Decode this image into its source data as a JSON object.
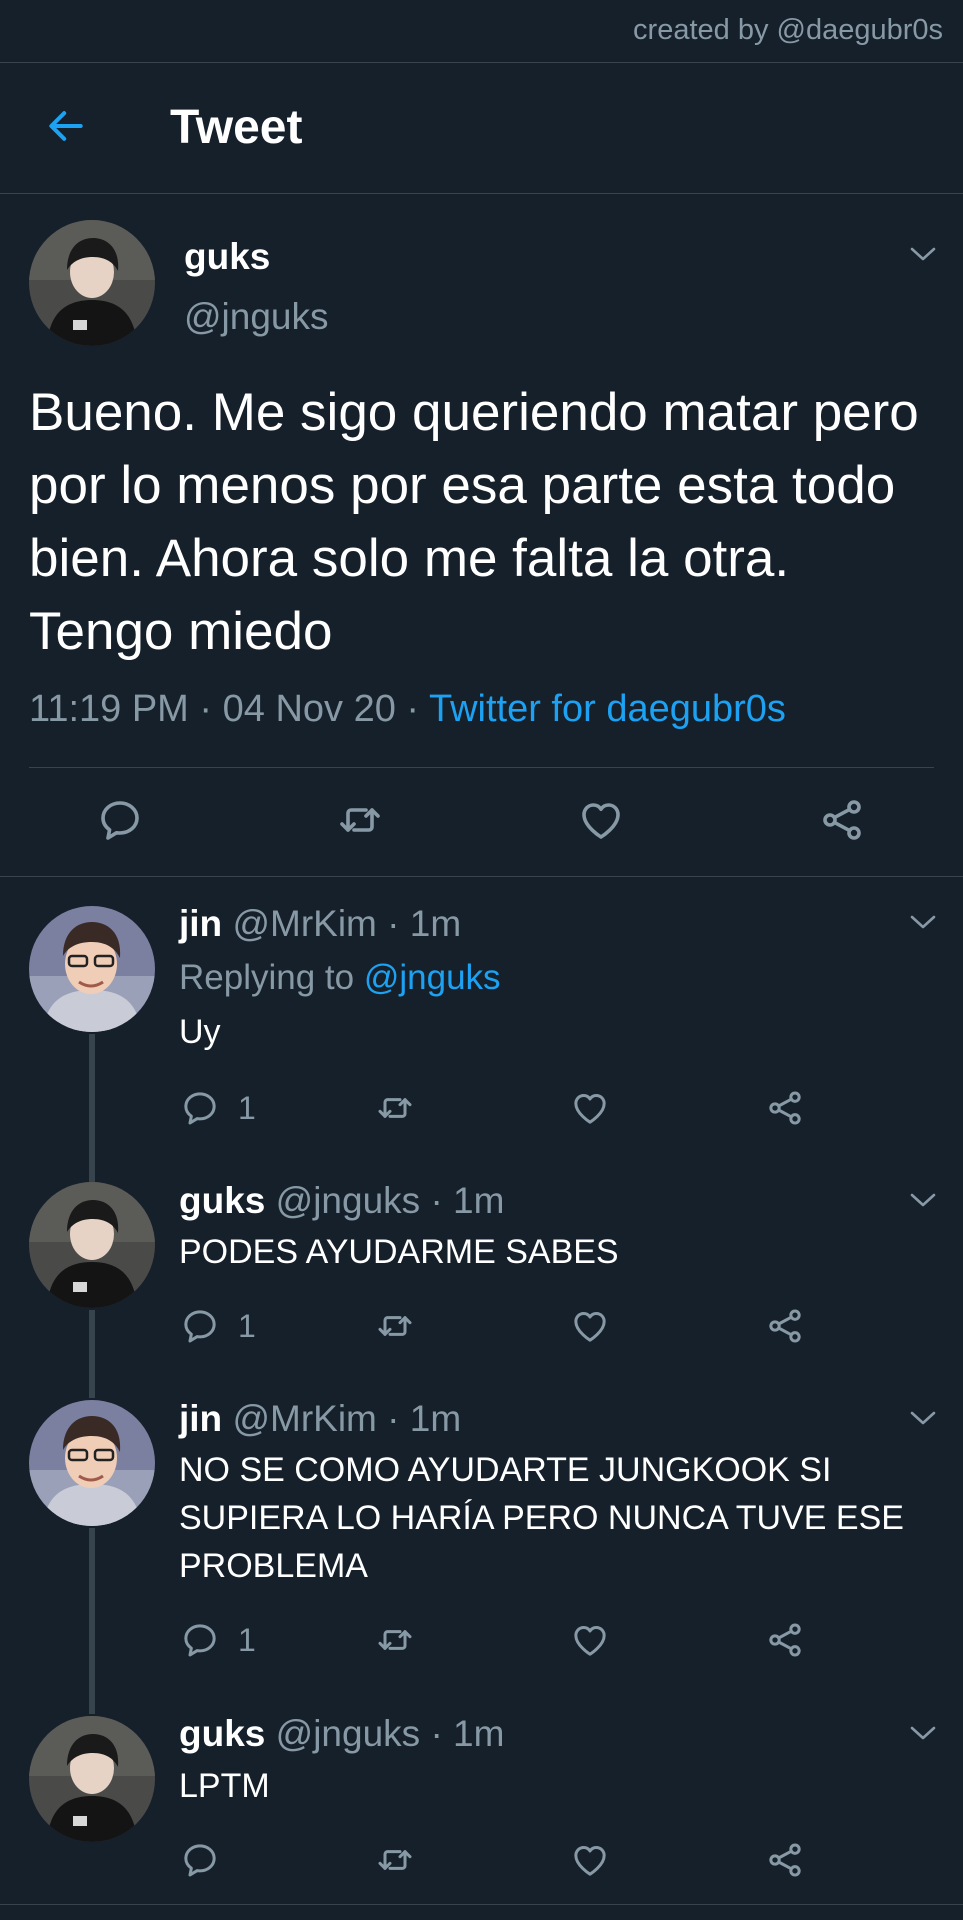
{
  "credit": "created by @daegubr0s",
  "header": {
    "title": "Tweet"
  },
  "main_tweet": {
    "name": "guks",
    "handle": "@jnguks",
    "text": "Bueno. Me sigo queriendo matar pero por lo menos por esa parte esta todo bien. Ahora solo me falta la otra. Tengo miedo",
    "time": "11:19 PM",
    "date": "04 Nov 20",
    "source": "Twitter for daegubr0s",
    "sep": "·"
  },
  "replies": [
    {
      "name": "jin",
      "handle": "@MrKim",
      "time": "1m",
      "replying_label": "Replying to",
      "replying_to": "@jnguks",
      "text": "Uy",
      "reply_count": "1"
    },
    {
      "name": "guks",
      "handle": "@jnguks",
      "time": "1m",
      "text": "PODES AYUDARME SABES",
      "reply_count": "1"
    },
    {
      "name": "jin",
      "handle": "@MrKim",
      "time": "1m",
      "text": "NO SE COMO AYUDARTE JUNGKOOK SI SUPIERA LO HARÍA PERO NUNCA TUVE ESE PROBLEMA",
      "reply_count": "1"
    },
    {
      "name": "guks",
      "handle": "@jnguks",
      "time": "1m",
      "text": "LPTM",
      "reply_count": ""
    }
  ],
  "colors": {
    "background": "#15202b",
    "accent": "#1da1f2",
    "muted": "#8899a6",
    "divider": "#38444d"
  },
  "icons": [
    "back-arrow-icon",
    "chevron-down-icon",
    "reply-icon",
    "retweet-icon",
    "like-icon",
    "share-icon"
  ]
}
